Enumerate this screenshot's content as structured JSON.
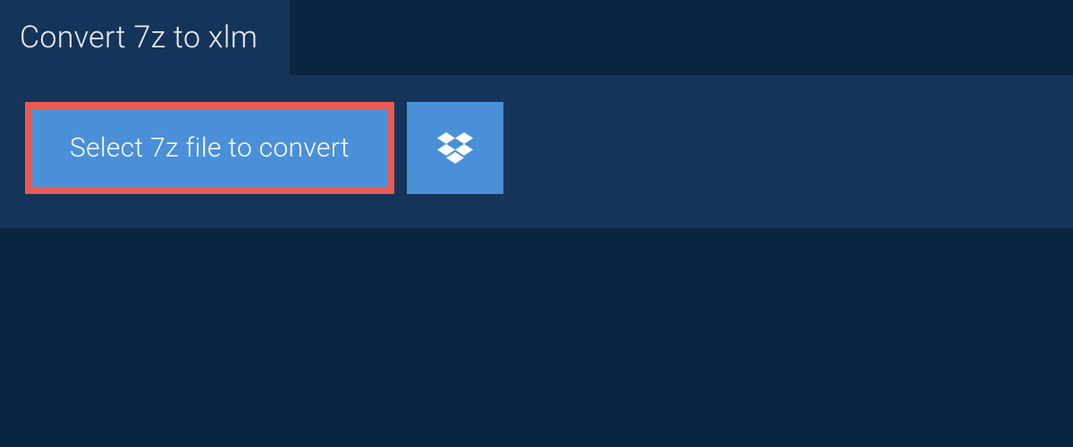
{
  "tab": {
    "label": "Convert 7z to xlm"
  },
  "actions": {
    "select_label": "Select 7z file to convert"
  },
  "colors": {
    "page_bg": "#0a2540",
    "panel_bg": "#15345a",
    "button_bg": "#4a90d9",
    "highlight_border": "#e85a4f",
    "text_light": "#e8eef5",
    "text_white": "#ffffff"
  }
}
